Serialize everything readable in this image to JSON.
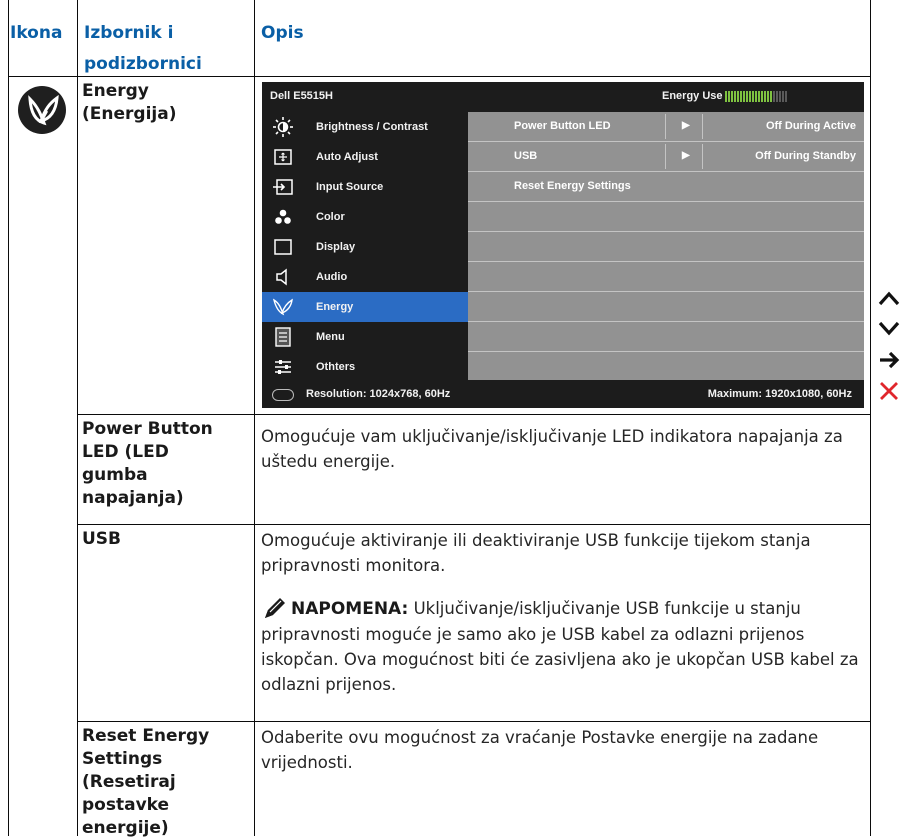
{
  "table": {
    "headers": {
      "icon": "Ikona",
      "menu": "Izbornik i podizbornici",
      "description": "Opis"
    },
    "energy": {
      "title": "Energy (Energija)",
      "icon": "energy-leaf-icon"
    },
    "rows": [
      {
        "name": "Power Button LED (LED gumba napajanja)",
        "description": "Omogućuje vam uključivanje/isključivanje LED indikatora napajanja za uštedu energije."
      },
      {
        "name": "USB",
        "description": "Omogućuje aktiviranje ili deaktiviranje USB funkcije tijekom stanja pripravnosti monitora.",
        "note_label": "NAPOMENA:",
        "note_text": " Uključivanje/isključivanje USB funkcije u stanju pripravnosti moguće je samo ako je USB kabel za odlazni prijenos iskopčan. Ova mogućnost biti će zasivljena ako je ukopčan USB kabel za odlazni prijenos."
      },
      {
        "name": "Reset Energy Settings (Resetiraj postavke energije)",
        "description": "Odaberite ovu mogućnost za vraćanje Postavke energije na zadane vrijednosti."
      }
    ]
  },
  "osd": {
    "model": "Dell E5515H",
    "energy_use_label": "Energy Use",
    "energy_level": {
      "filled": 16,
      "total": 21
    },
    "menu_items": [
      {
        "label": "Brightness / Contrast",
        "icon": "brightness-icon"
      },
      {
        "label": "Auto Adjust",
        "icon": "auto-adjust-icon"
      },
      {
        "label": "Input Source",
        "icon": "input-source-icon"
      },
      {
        "label": "Color",
        "icon": "color-icon"
      },
      {
        "label": "Display",
        "icon": "display-icon"
      },
      {
        "label": "Audio",
        "icon": "audio-icon"
      },
      {
        "label": "Energy",
        "icon": "energy-icon",
        "active": true
      },
      {
        "label": "Menu",
        "icon": "menu-icon"
      },
      {
        "label": "Othters",
        "icon": "others-icon"
      }
    ],
    "sub_items": [
      {
        "label": "Power Button LED",
        "value": "Off During Active"
      },
      {
        "label": "USB",
        "value": "Off During Standby"
      },
      {
        "label": "Reset Energy Settings",
        "value": ""
      }
    ],
    "footer_resolution": "Resolution: 1024x768, 60Hz",
    "footer_maximum": "Maximum: 1920x1080, 60Hz"
  },
  "nav_buttons": [
    "up-arrow-icon",
    "down-arrow-icon",
    "right-arrow-icon",
    "close-icon"
  ],
  "colors": {
    "header_blue": "#0a5fa6",
    "osd_active": "#2b6cc4",
    "energy_green": "#7fc241",
    "close_red": "#e0262c"
  }
}
